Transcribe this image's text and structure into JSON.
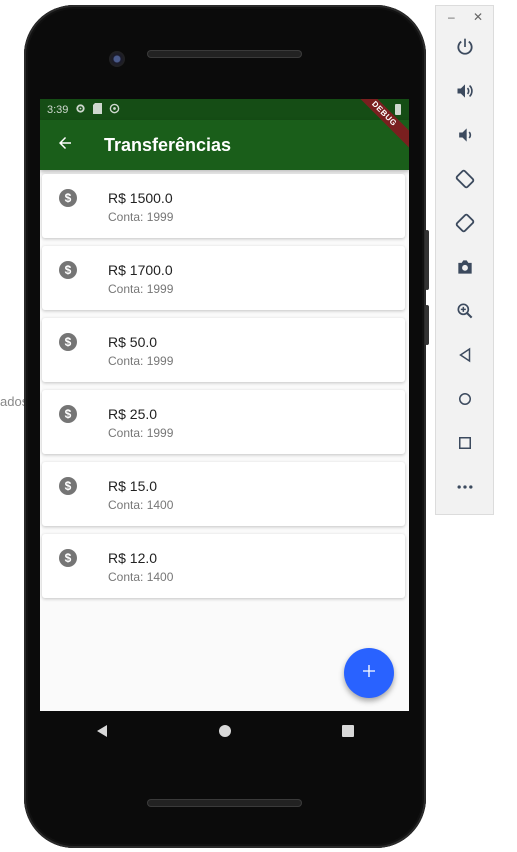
{
  "background_text": "ados",
  "status_bar": {
    "time": "3:39"
  },
  "app_bar": {
    "title": "Transferências",
    "debug_label": "DEBUG"
  },
  "transfers": [
    {
      "value": "R$ 1500.0",
      "account": "Conta: 1999"
    },
    {
      "value": "R$ 1700.0",
      "account": "Conta: 1999"
    },
    {
      "value": "R$ 50.0",
      "account": "Conta: 1999"
    },
    {
      "value": "R$ 25.0",
      "account": "Conta: 1999"
    },
    {
      "value": "R$ 15.0",
      "account": "Conta: 1400"
    },
    {
      "value": "R$ 12.0",
      "account": "Conta: 1400"
    }
  ],
  "fab": {
    "icon": "add-icon",
    "symbol": "+"
  },
  "emulator_toolbar": {
    "minimize": "–",
    "close": "✕",
    "buttons": [
      "power-icon",
      "volume-up-icon",
      "volume-down-icon",
      "rotate-left-icon",
      "rotate-right-icon",
      "camera-icon",
      "zoom-icon",
      "back-icon",
      "home-icon",
      "overview-icon",
      "more-icon"
    ]
  },
  "colors": {
    "app_bar": "#1a5e1a",
    "status_bar": "#154d15",
    "fab": "#2962ff",
    "toolbar_icon": "#3c4a5e"
  }
}
